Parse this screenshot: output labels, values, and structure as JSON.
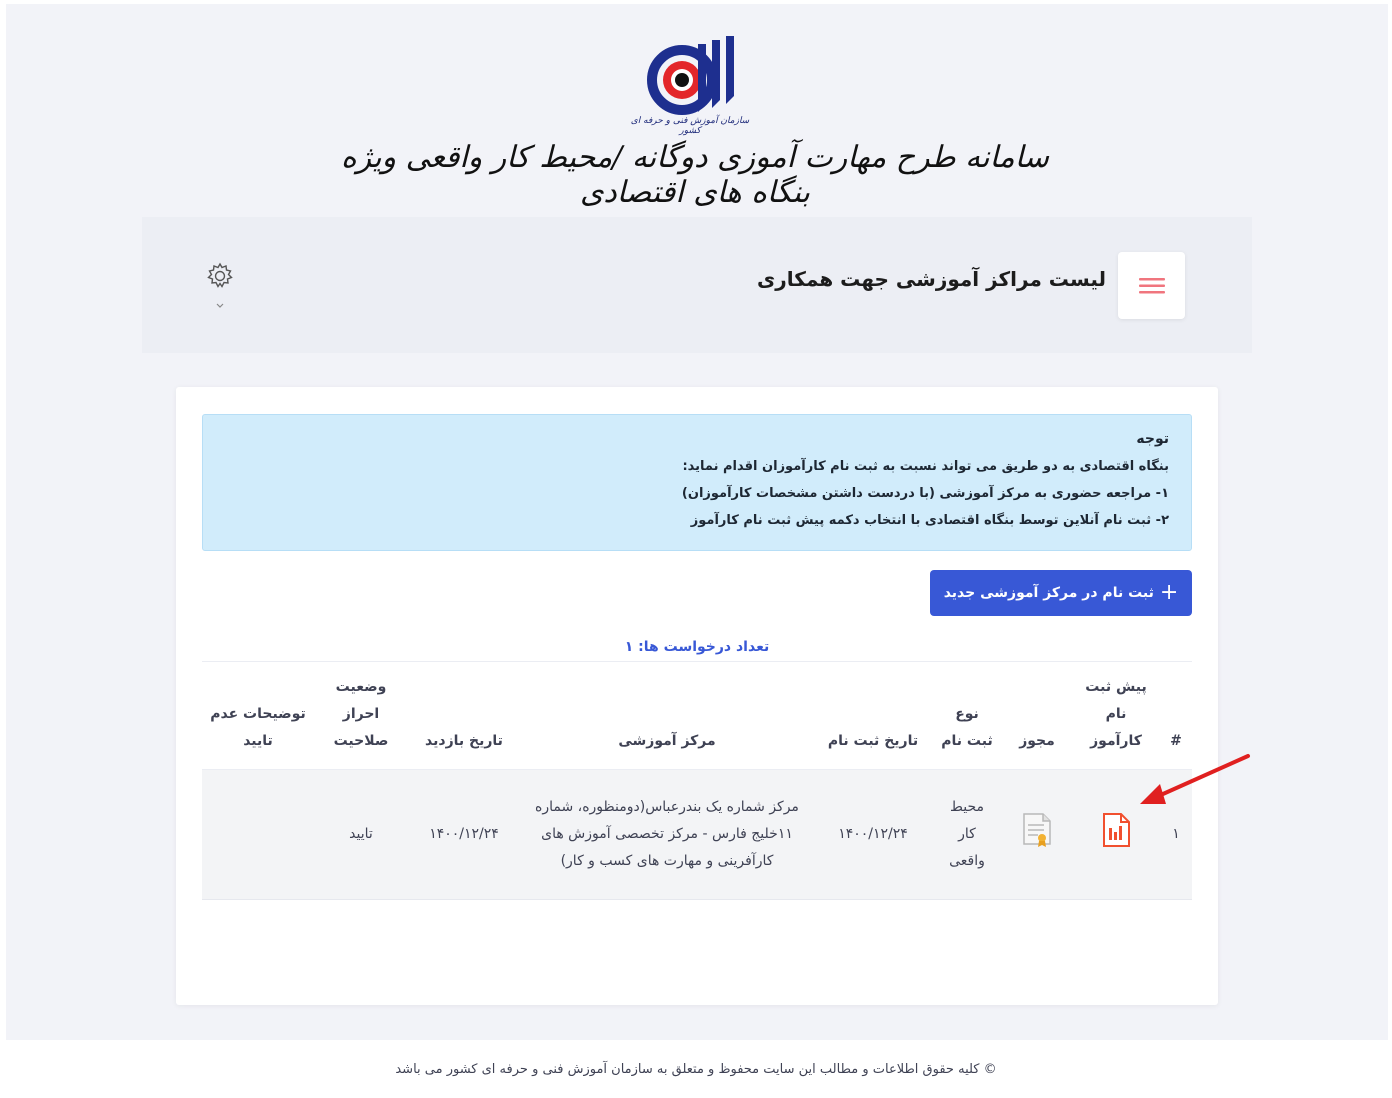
{
  "header": {
    "logo_caption": "سازمان آموزش فنی و حرفه ای کشور",
    "system_title": "سامانه طرح مهارت آموزی دوگانه /محیط کار واقعی ویژه بنگاه های اقتصادی"
  },
  "subheader": {
    "page_title": "لیست مراکز آموزشی جهت همکاری"
  },
  "alert": {
    "title": "توجه",
    "lines": [
      "بنگاه اقتصادی به دو طریق می تواند نسبت به ثبت نام کارآموزان اقدام نماید:",
      "۱- مراجعه حضوری به مرکز آموزشی (با دردست داشتن مشخصات کارآموزان)",
      "۲- ثبت نام آنلاین توسط بنگاه اقتصادی با انتخاب دکمه پیش ثبت نام کارآموز"
    ]
  },
  "new_button": {
    "plus": "+",
    "label": "ثبت نام در مرکز آموزشی جدید"
  },
  "requests": {
    "count_label": "تعداد درخواست ها: ۱"
  },
  "table": {
    "headers": [
      "#",
      "پیش ثبت نام کارآموز",
      "مجوز",
      "نوع ثبت نام",
      "تاریخ ثبت نام",
      "مرکز آموزشی",
      "تاریخ بازدید",
      "وضعیت احراز صلاحیت",
      "توضیحات عدم تایید"
    ],
    "rows": [
      {
        "index": "۱",
        "registration_type": "محیط کار واقعی",
        "registration_date": "۱۴۰۰/۱۲/۲۴",
        "center": "مرکز شماره یک بندرعباس(دومنظوره، شماره ۱۱خلیج فارس - مرکز تخصصی آموزش های کارآفرینی و مهارت های کسب و کار)",
        "visit_date": "۱۴۰۰/۱۲/۲۴",
        "status": "تایید",
        "rejection_notes": ""
      }
    ]
  },
  "footer": {
    "copyright": "© کلیه حقوق اطلاعات و مطالب این سایت محفوظ و متعلق به سازمان آموزش فنی و حرفه ای کشور می باشد"
  },
  "colors": {
    "primary": "#3858d6",
    "alert_bg": "#d1ecfb",
    "pdf_red": "#f1502f",
    "arrow_red": "#e02020"
  },
  "icons": [
    "logo-icon",
    "hamburger-menu-icon",
    "gear-icon",
    "chevron-down-icon",
    "pdf-file-icon",
    "certificate-icon",
    "arrow-annotation-icon"
  ]
}
